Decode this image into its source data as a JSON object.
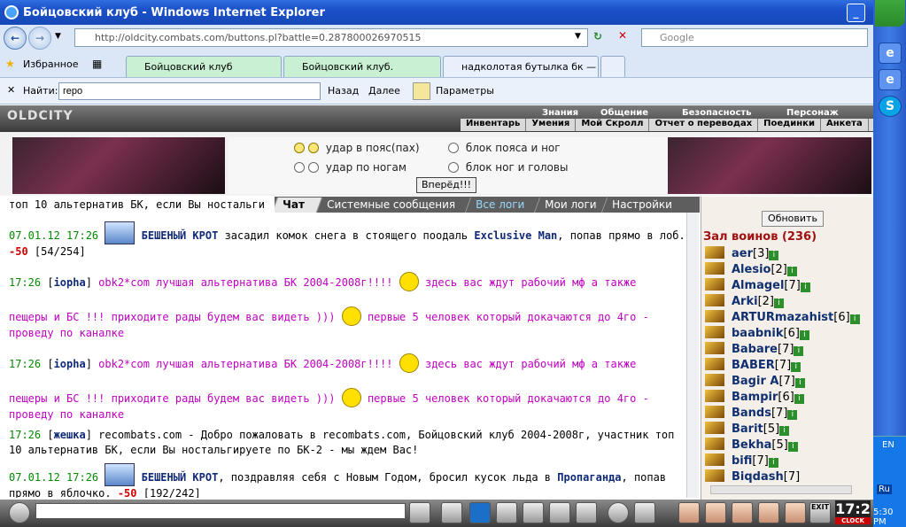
{
  "window": {
    "title": "Бойцовский клуб - Windows Internet Explorer"
  },
  "address": {
    "url": "http://oldcity.combats.com/buttons.pl?battle=0.287800026970515",
    "search_placeholder": "Google"
  },
  "favorites": {
    "label": "Избранное"
  },
  "tabs": [
    {
      "label": "Бойцовский клуб",
      "active": true
    },
    {
      "label": "Бойцовский клуб.",
      "active": false
    },
    {
      "label": "надколотая бутылка бк — ...",
      "active": false
    }
  ],
  "find": {
    "label": "Найти:",
    "value": "геро",
    "prev": "Назад",
    "next": "Далее",
    "params": "Параметры"
  },
  "game_menu": {
    "logo": "OLDCITY",
    "top": [
      "Знания",
      "Общение",
      "Безопасность",
      "Персонаж"
    ],
    "sub": [
      "Инвентарь",
      "Умения",
      "Мой Скролл",
      "Отчет о переводах",
      "Поединки",
      "Анкета"
    ]
  },
  "battle": {
    "attack": [
      "удар в пояс(пах)",
      "удар по ногам"
    ],
    "block": [
      "блок пояса и ног",
      "блок ног и головы"
    ],
    "submit": "Вперёд!!!"
  },
  "chat_tabs": [
    "Чат",
    "Системные сообщения",
    "Все логи",
    "Мои логи",
    "Настройки"
  ],
  "chat": {
    "top_line": "топ 10 альтернатив БК, если Вы ностальги",
    "m1": {
      "time": "07.01.12 17:26",
      "nick": "БЕШЕНЫЙ КРОТ",
      "t1": "засадил комок снега в стоящего поодаль",
      "target": "Exclusive Man",
      "t2": ", попав прямо в лоб.",
      "dmg": "-50",
      "hp": "[54/254]"
    },
    "m2": {
      "time": "17:26",
      "nick": "iopha",
      "t1": "obk2*com лучшая альтернатива БК 2004-2008г!!!!",
      "t2": "здесь вас ждут рабочий мф а также",
      "t3": "пещеры и БС !!! приходите рады будем вас видеть )))",
      "t4": "первые 5 человек который докачаются до 4го - проведу по каналке"
    },
    "m3": {
      "time": "17:26",
      "nick": "iopha",
      "t1": "obk2*com лучшая альтернатива БК 2004-2008г!!!!",
      "t2": "здесь вас ждут рабочий мф а также",
      "t3": "пещеры и БС !!! приходите рады будем вас видеть )))",
      "t4": "первые 5 человек который докачаются до 4го - проведу по каналке"
    },
    "m4": {
      "time": "17:26",
      "nick": "жешка",
      "text": "recombats.com - Добро пожаловать в recombats.com, Бойцовский клуб 2004-2008г, участник топ 10 альтернатив БК, если Вы ностальгируете по БК-2 - мы ждем Вас!"
    },
    "m5": {
      "time": "07.01.12 17:26",
      "nick": "БЕШЕНЫЙ КРОТ",
      "t1": ", поздравляя себя с Новым Годом, бросил кусок льда в",
      "target": "Пропаганда",
      "t2": ", попав прямо в яблочко.",
      "dmg": "-50",
      "hp": "[192/242]"
    }
  },
  "right": {
    "refresh": "Обновить",
    "hall": "Зал воинов (236)",
    "players": [
      {
        "name": "aer",
        "level": "[3]"
      },
      {
        "name": "Alesio",
        "level": "[2]"
      },
      {
        "name": "Almagel",
        "level": "[7]"
      },
      {
        "name": "Arki",
        "level": "[2]"
      },
      {
        "name": "ARTURmazahist",
        "level": "[6]"
      },
      {
        "name": "baabnik",
        "level": "[6]"
      },
      {
        "name": "Babare",
        "level": "[7]"
      },
      {
        "name": "BABER",
        "level": "[7]"
      },
      {
        "name": "Bagir A",
        "level": "[7]"
      },
      {
        "name": "Bampir",
        "level": "[6]"
      },
      {
        "name": "Bands",
        "level": "[7]"
      },
      {
        "name": "Barit",
        "level": "[5]"
      },
      {
        "name": "Bekha",
        "level": "[5]"
      },
      {
        "name": "bifi",
        "level": "[7]"
      },
      {
        "name": "Biqdash",
        "level": "[7]"
      }
    ]
  },
  "bottom": {
    "clock": "17:2",
    "clock_label": "CLOCK",
    "exit": "EXIT"
  },
  "taskbar": {
    "lang": "EN",
    "lang2": "Ru",
    "time": "5:30 PM"
  }
}
